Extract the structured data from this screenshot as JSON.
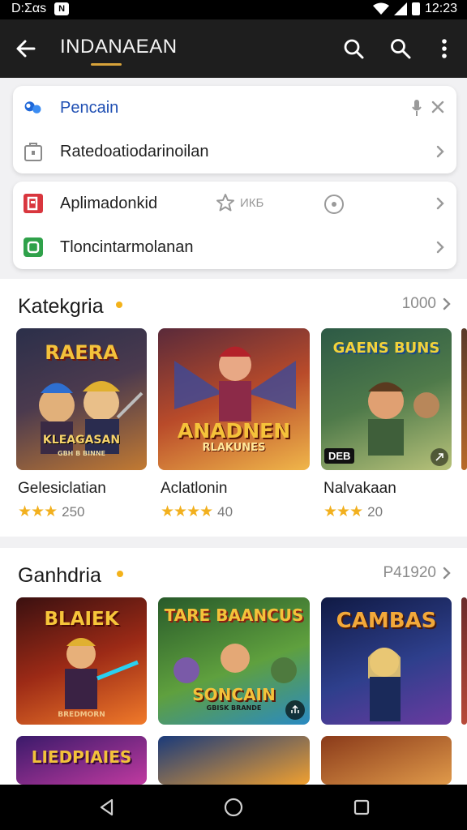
{
  "status_bar": {
    "time_left": "D:Σαs",
    "time_right": "12:23"
  },
  "app_bar": {
    "title": "INDANAEAN"
  },
  "menu": {
    "card1": [
      {
        "label": "Pencain",
        "icon": "people-icon"
      },
      {
        "label": "Ratedoatiodarinoilan",
        "icon": "bag-icon"
      }
    ],
    "card2": [
      {
        "label": "Aplimadonkid",
        "icon": "app-icon",
        "rating_text": "ИКБ"
      },
      {
        "label": "Tloncintarmolanan",
        "icon": "device-icon"
      }
    ]
  },
  "sections": [
    {
      "title": "Katekgria",
      "more": "1000",
      "games": [
        {
          "name": "Gelesiclatian",
          "rating": "250",
          "stars": "★★★",
          "art_title": "RAERA",
          "art_sub": "KLEAGASAN",
          "art_sub2": "GBH B BINNE",
          "colors": [
            "#2b2f4a",
            "#6a3d2a",
            "#d58b2e"
          ]
        },
        {
          "name": "Aclatlonin",
          "rating": "40",
          "stars": "★★★★",
          "art_title": "ANADNEN",
          "art_sub": "RLAKUNES",
          "art_sub2": "",
          "colors": [
            "#5a2a3a",
            "#d8642a",
            "#f0b64a"
          ]
        },
        {
          "name": "Nalvakaan",
          "rating": "20",
          "stars": "★★★",
          "art_title": "GAENS BUNS",
          "art_sub": "",
          "art_sub2": "",
          "badge": "DEB",
          "colors": [
            "#2d5a46",
            "#6c8c4a",
            "#b8c27a"
          ]
        }
      ]
    },
    {
      "title": "Ganhdria",
      "more": "P41920",
      "games": [
        {
          "art_title": "BLAIEK",
          "art_sub": "BREDMORN",
          "colors": [
            "#3a1010",
            "#b8361a",
            "#f07a2a"
          ]
        },
        {
          "art_title": "TARE BAANCUS",
          "art_sub": "SONCAIN",
          "art_sub2": "GBISK BRANDE",
          "colors": [
            "#285a2a",
            "#5fa03e",
            "#2a8ac2"
          ]
        },
        {
          "art_title": "CAMBAS",
          "art_sub": "",
          "colors": [
            "#101a44",
            "#2e3f8c",
            "#6a3aa0"
          ]
        }
      ]
    }
  ],
  "partial_third": {
    "art_title": "LIEDPIAIES"
  }
}
